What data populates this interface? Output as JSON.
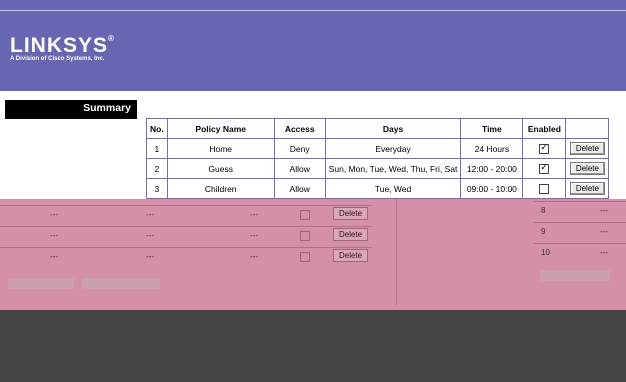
{
  "header": {
    "logo": "LINKSYS",
    "logo_mark": "®",
    "subtitle": "A Division of Cisco Systems, Inc."
  },
  "nav": {
    "active_label": "Summary"
  },
  "table": {
    "headers": [
      "No.",
      "Policy Name",
      "Access",
      "Days",
      "Time",
      "Enabled",
      ""
    ],
    "rows": [
      {
        "no": "1",
        "name": "Home",
        "access": "Deny",
        "days": "Everyday",
        "time": "24 Hours",
        "enabled": true,
        "delete": "Delete"
      },
      {
        "no": "2",
        "name": "Guess",
        "access": "Allow",
        "days": "Sun, Mon, Tue, Wed, Thu, Fri, Sat",
        "time": "12:00 - 20:00",
        "enabled": true,
        "delete": "Delete"
      },
      {
        "no": "3",
        "name": "Children",
        "access": "Allow",
        "days": "Tue, Wed",
        "time": "09:00 - 10:00",
        "enabled": false,
        "delete": "Delete"
      }
    ]
  },
  "overlay_left_rows": [
    {
      "name": "---",
      "access": "---",
      "days": "---",
      "delete": "Delete"
    },
    {
      "name": "---",
      "access": "---",
      "days": "---",
      "delete": "Delete"
    },
    {
      "name": "---",
      "access": "---",
      "days": "---",
      "delete": "Delete"
    }
  ],
  "overlay_right_rows": [
    {
      "no": "8",
      "value": "---"
    },
    {
      "no": "9",
      "value": "---"
    },
    {
      "no": "10",
      "value": "---"
    }
  ]
}
